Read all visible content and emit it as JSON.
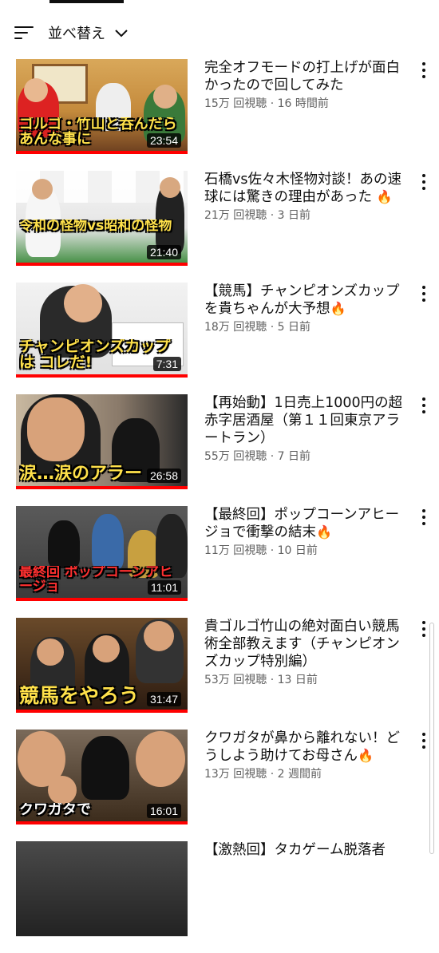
{
  "sort": {
    "label": "並べ替え"
  },
  "videos": [
    {
      "title": "完全オフモードの打上げが面白かったので回してみた",
      "stats": "15万 回視聴 · 16 時間前",
      "duration": "23:54",
      "caption": "ゴルゴ・竹山と呑んだら あんな事に",
      "hot": false
    },
    {
      "title": "石橋vs佐々木怪物対談！あの速球には驚きの理由があった",
      "stats": "21万 回視聴 · 3 日前",
      "duration": "21:40",
      "caption": "令和の怪物vs昭和の怪物",
      "hot": true
    },
    {
      "title": "【競馬】チャンピオンズカップを貴ちゃんが大予想",
      "stats": "18万 回視聴 · 5 日前",
      "duration": "7:31",
      "caption": "チャンピオンズカップは コレだ!",
      "hot": true
    },
    {
      "title": "【再始動】1日売上1000円の超赤字居酒屋（第１１回東京アラートラン）",
      "stats": "55万 回視聴 · 7 日前",
      "duration": "26:58",
      "caption": "涙…涙のアラー",
      "hot": false
    },
    {
      "title": "【最終回】ポップコーンアヒージョで衝撃の結末",
      "stats": "11万 回視聴 · 10 日前",
      "duration": "11:01",
      "caption": "最終回 ポップコーンアヒージョ",
      "hot": true
    },
    {
      "title": "貴ゴルゴ竹山の絶対面白い競馬術全部教えます（チャンピオンズカップ特別編）",
      "stats": "53万 回視聴 · 13 日前",
      "duration": "31:47",
      "caption": "競馬をやろう",
      "hot": true
    },
    {
      "title": "クワガタが鼻から離れない！どうしよう助けてお母さん",
      "stats": "13万 回視聴 · 2 週間前",
      "duration": "16:01",
      "caption": "クワガタで",
      "hot": true
    },
    {
      "title": "【激熱回】タカゲーム脱落者",
      "stats": "",
      "duration": "",
      "caption": "",
      "hot": false
    }
  ]
}
